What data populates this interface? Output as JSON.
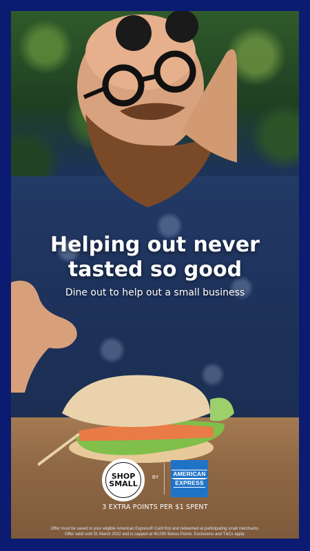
{
  "ad": {
    "headline_line1": "Helping out never",
    "headline_line2": "tasted so good",
    "subheadline": "Dine out to help out a small business",
    "shop_small_line1": "SHOP",
    "shop_small_line2": "SMALL",
    "by_label": "BY",
    "amex_line1": "AMERICAN",
    "amex_line2": "EXPRESS",
    "points_text": "3 EXTRA POINTS PER $1 SPENT",
    "fineprint_line1": "Offer must be saved to your eligible American Express® Card first and redeemed at participating small merchants.",
    "fineprint_line2": "Offer valid until 31 March 2022 and is capped at 40,000 Bonus Points. Exclusions and T&Cs apply."
  },
  "colors": {
    "frame": "#0b1b72",
    "amex_blue": "#1f73c7",
    "text": "#ffffff"
  },
  "icons": {
    "shop_small_logo": "shop-small-logo",
    "amex_logo": "amex-logo"
  }
}
